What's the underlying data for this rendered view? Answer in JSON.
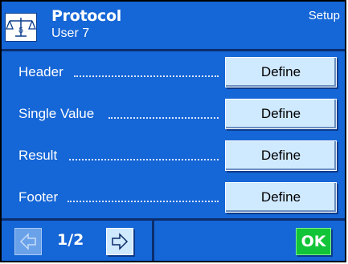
{
  "header": {
    "title": "Protocol",
    "subtitle": "User 7",
    "right_label": "Setup",
    "icon": "balance-scale-icon"
  },
  "rows": [
    {
      "label": "Header",
      "button": "Define"
    },
    {
      "label": "Single Value",
      "button": "Define"
    },
    {
      "label": "Result",
      "button": "Define"
    },
    {
      "label": "Footer",
      "button": "Define"
    }
  ],
  "footer": {
    "page_indicator": "1/2",
    "prev_icon": "arrow-left-icon",
    "next_icon": "arrow-right-icon",
    "ok_label": "OK"
  },
  "colors": {
    "background": "#1566d6",
    "button": "#cfe9ff",
    "ok": "#12c437",
    "divider": "#0b2e6e"
  }
}
